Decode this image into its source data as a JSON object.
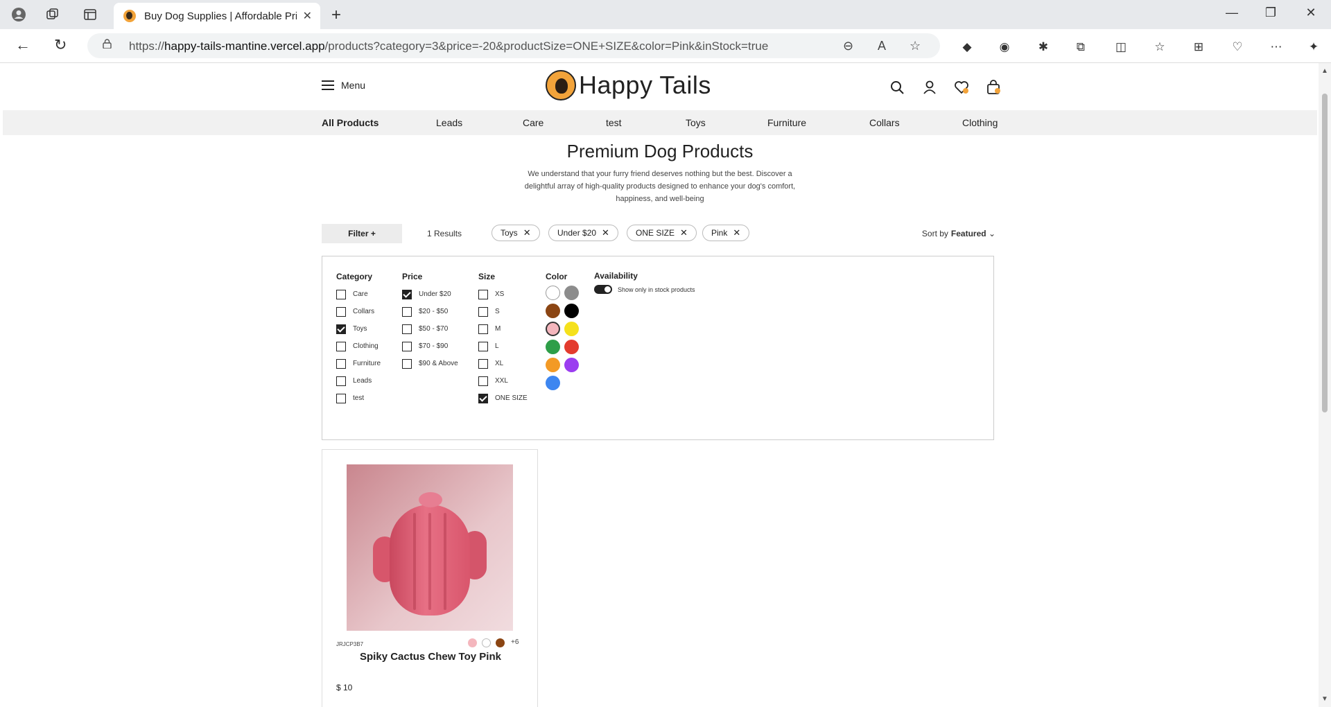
{
  "browser": {
    "tab_title": "Buy Dog Supplies | Affordable Pri",
    "url_prefix": "https://",
    "url_host": "happy-tails-mantine.vercel.app",
    "url_path": "/products?category=3&price=-20&productSize=ONE+SIZE&color=Pink&inStock=true"
  },
  "header": {
    "menu_label": "Menu",
    "logo_text": "Happy Tails"
  },
  "categories": [
    "All Products",
    "Leads",
    "Care",
    "test",
    "Toys",
    "Furniture",
    "Collars",
    "Clothing"
  ],
  "hero": {
    "title": "Premium Dog Products",
    "description": "We understand that your furry friend deserves nothing but the best. Discover a delightful array of high-quality products designed to enhance your dog's comfort, happiness, and well-being"
  },
  "filterbar": {
    "filter_label": "Filter +",
    "results": "1 Results",
    "chips": [
      "Toys",
      "Under $20",
      "ONE SIZE",
      "Pink"
    ],
    "sort_label": "Sort by",
    "sort_value": "Featured"
  },
  "filters": {
    "category": {
      "heading": "Category",
      "options": [
        {
          "label": "Care",
          "checked": false
        },
        {
          "label": "Collars",
          "checked": false
        },
        {
          "label": "Toys",
          "checked": true
        },
        {
          "label": "Clothing",
          "checked": false
        },
        {
          "label": "Furniture",
          "checked": false
        },
        {
          "label": "Leads",
          "checked": false
        },
        {
          "label": "test",
          "checked": false
        }
      ]
    },
    "price": {
      "heading": "Price",
      "options": [
        {
          "label": "Under $20",
          "checked": true
        },
        {
          "label": "$20 - $50",
          "checked": false
        },
        {
          "label": "$50 - $70",
          "checked": false
        },
        {
          "label": "$70 - $90",
          "checked": false
        },
        {
          "label": "$90 & Above",
          "checked": false
        }
      ]
    },
    "size": {
      "heading": "Size",
      "options": [
        {
          "label": "XS",
          "checked": false
        },
        {
          "label": "S",
          "checked": false
        },
        {
          "label": "M",
          "checked": false
        },
        {
          "label": "L",
          "checked": false
        },
        {
          "label": "XL",
          "checked": false
        },
        {
          "label": "XXL",
          "checked": false
        },
        {
          "label": "ONE SIZE",
          "checked": true
        }
      ]
    },
    "color": {
      "heading": "Color",
      "swatches": [
        "#ffffff",
        "#8c8c8c",
        "#8b4513",
        "#000000",
        "#f4b6bd",
        "#f5e11c",
        "#2e9e48",
        "#e33b2e",
        "#f39a25",
        "#9b3df0",
        "#3d86f0"
      ],
      "selected": "#f4b6bd"
    },
    "availability": {
      "heading": "Availability",
      "toggle_label": "Show only in stock products",
      "on": true
    }
  },
  "product": {
    "sku": "JRJCP3B7",
    "name": "Spiky Cactus Chew Toy Pink",
    "price": "$ 10",
    "colors": [
      "#f4b6bd",
      "#ffffff",
      "#8b4513"
    ],
    "more_colors": "+6"
  },
  "icons": [
    "search-icon",
    "user-icon",
    "heart-icon",
    "bag-icon"
  ]
}
